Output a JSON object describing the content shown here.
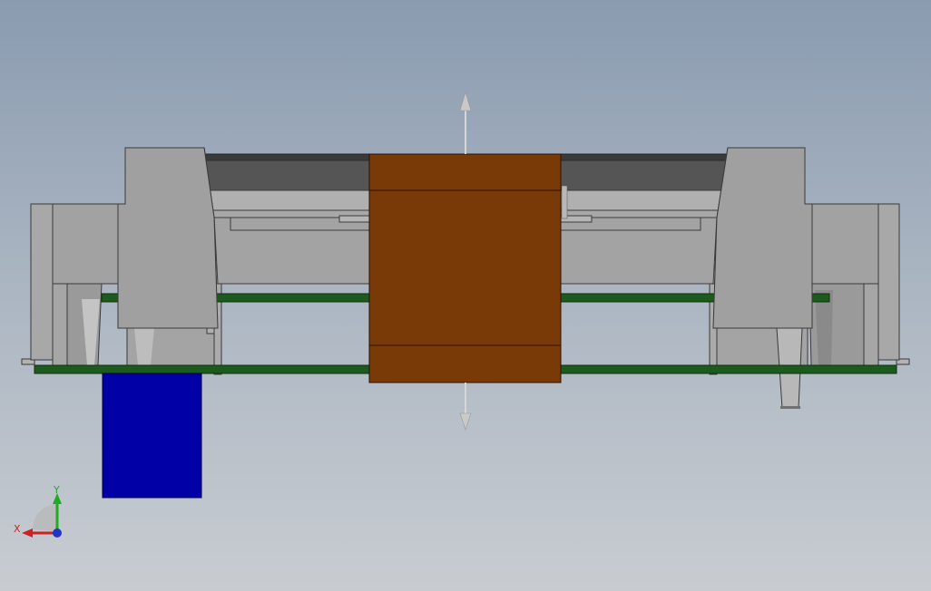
{
  "viewport": {
    "colors": {
      "background_top": "#8a9bb0",
      "background_bottom": "#c8ccd1",
      "housing_gray": "#a0a0a0",
      "rail_dark": "#505050",
      "pcb_green": "#1d5a1d",
      "core_brown": "#7a3a08",
      "block_blue": "#0000a6"
    },
    "drag_handle": {
      "icon": "double-arrow-vertical-icon"
    },
    "triad": {
      "y_label": "Y",
      "x_label": "X",
      "y_color": "#22aa22",
      "x_color": "#cc2222",
      "z_color": "#2233cc"
    }
  }
}
